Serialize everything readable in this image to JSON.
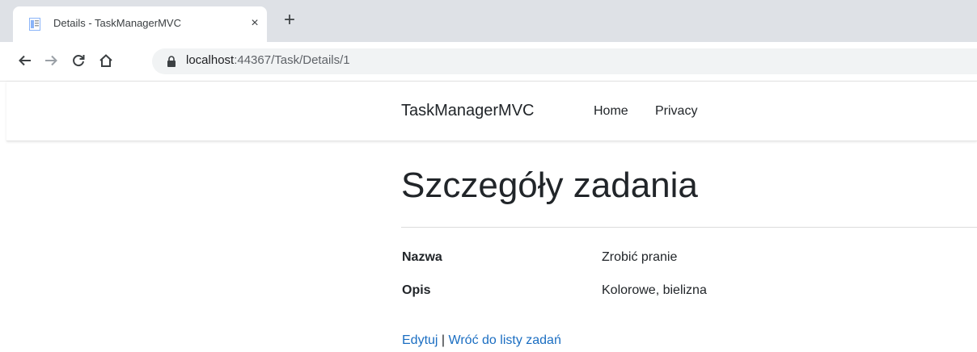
{
  "browser": {
    "tab": {
      "title": "Details - TaskManagerMVC",
      "close": "×"
    },
    "new_tab": "+",
    "address": {
      "host": "localhost",
      "path": ":44367/Task/Details/1"
    }
  },
  "navbar": {
    "brand": "TaskManagerMVC",
    "links": [
      "Home",
      "Privacy"
    ]
  },
  "page": {
    "title": "Szczegóły zadania",
    "fields": [
      {
        "label": "Nazwa",
        "value": "Zrobić pranie"
      },
      {
        "label": "Opis",
        "value": "Kolorowe, bielizna"
      }
    ],
    "actions": {
      "edit": "Edytuj",
      "separator": "|",
      "back": "Wróć do listy zadań"
    }
  },
  "colors": {
    "link": "#1b6ec2",
    "text": "#212529",
    "tabstrip": "#dee1e6"
  }
}
